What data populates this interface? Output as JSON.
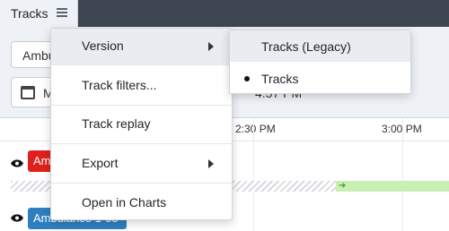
{
  "header": {
    "title": "Tracks",
    "menu_icon": "hamburger-menu-icon"
  },
  "toolbar": {
    "vehicle_select_value": "Ambu",
    "date_value": "M",
    "time_partial": "4:57 PM",
    "calendar_icon": "calendar-icon"
  },
  "timeline": {
    "ticks": [
      "2:30 PM",
      "3:00 PM"
    ]
  },
  "tracks": [
    {
      "label": "Am",
      "color": "#e0201c",
      "visibility_icon": "eye-icon"
    },
    {
      "label": "Ambulance 1-05",
      "color": "#2f7fbf",
      "visibility_icon": "eye-icon"
    }
  ],
  "context_menu": {
    "items": [
      {
        "label": "Version",
        "has_submenu": true
      },
      {
        "label": "Track filters...",
        "has_submenu": false
      },
      {
        "label": "Track replay",
        "has_submenu": false
      },
      {
        "label": "Export",
        "has_submenu": true
      },
      {
        "label": "Open in Charts",
        "has_submenu": false
      }
    ]
  },
  "version_submenu": {
    "items": [
      {
        "label": "Tracks (Legacy)",
        "selected": false
      },
      {
        "label": "Tracks",
        "selected": true
      }
    ]
  }
}
